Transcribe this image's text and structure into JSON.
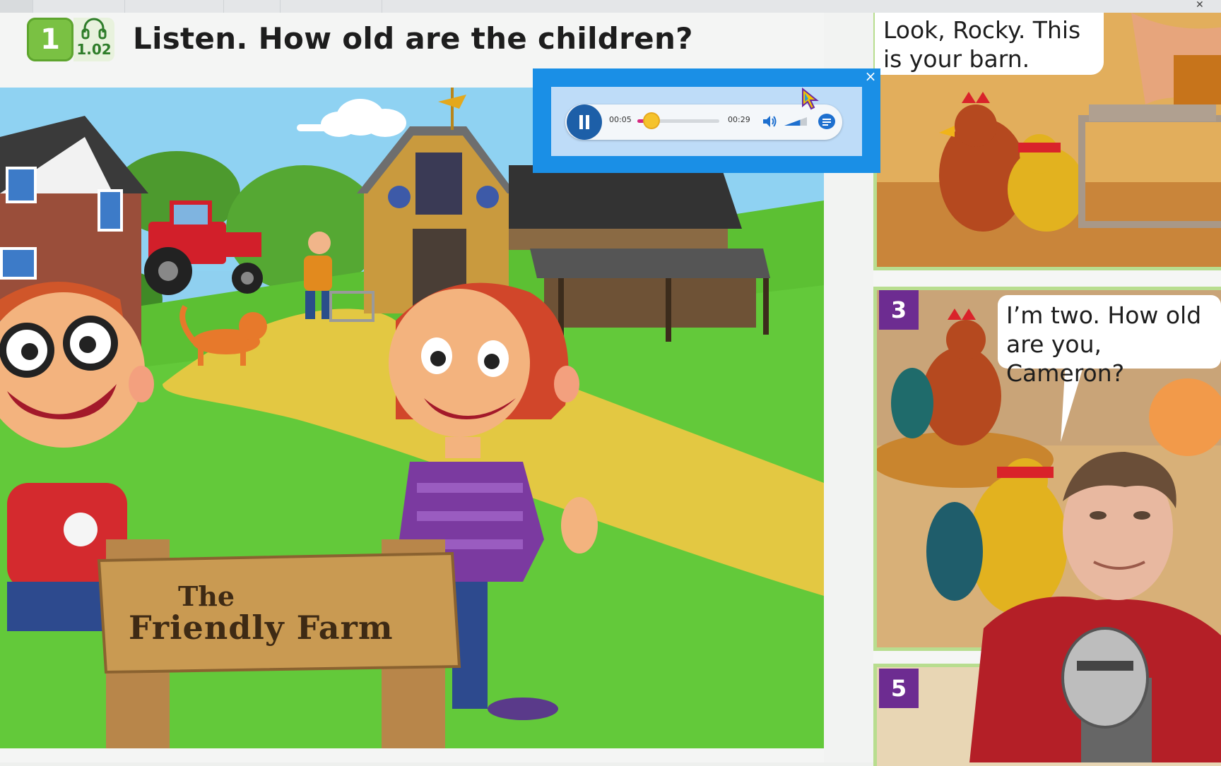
{
  "window": {
    "tabs": [
      "",
      "",
      "",
      "",
      ""
    ]
  },
  "exercise": {
    "number": "1",
    "track": "1.02",
    "title": "Listen. How old are the children?"
  },
  "scene": {
    "sign_line1": "The",
    "sign_line2": "Friendly Farm"
  },
  "audio_player": {
    "current_time": "00:05",
    "total_time": "00:29",
    "progress": 0.17,
    "volume": 0.7,
    "close_label": "×"
  },
  "comic": {
    "top_bubble": [
      "Look, Rocky. This",
      "is your barn."
    ],
    "panel_mid_number": "3",
    "mid_bubble": [
      "I’m two. How old",
      "are you, Cameron?"
    ],
    "panel_bot_number": "5"
  },
  "colors": {
    "accent_blue": "#1a8fe6",
    "badge_green": "#7ac143",
    "panel_purple": "#6d2c91",
    "progress_pink": "#d6267e"
  }
}
